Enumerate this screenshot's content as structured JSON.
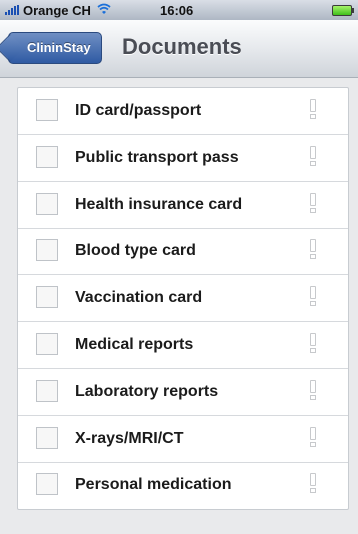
{
  "status_bar": {
    "carrier": "Orange CH",
    "time": "16:06"
  },
  "nav": {
    "back_label": "ClininStay",
    "title": "Documents"
  },
  "documents": [
    {
      "label": "ID card/passport",
      "checked": false
    },
    {
      "label": "Public transport pass",
      "checked": false
    },
    {
      "label": "Health insurance card",
      "checked": false
    },
    {
      "label": "Blood type card",
      "checked": false
    },
    {
      "label": "Vaccination card",
      "checked": false
    },
    {
      "label": "Medical reports",
      "checked": false
    },
    {
      "label": "Laboratory reports",
      "checked": false
    },
    {
      "label": "X-rays/MRI/CT",
      "checked": false
    },
    {
      "label": "Personal medication",
      "checked": false
    }
  ],
  "colors": {
    "back_button": "#3b66ad",
    "title_text": "#4a4d55",
    "background": "#e9eaec"
  }
}
